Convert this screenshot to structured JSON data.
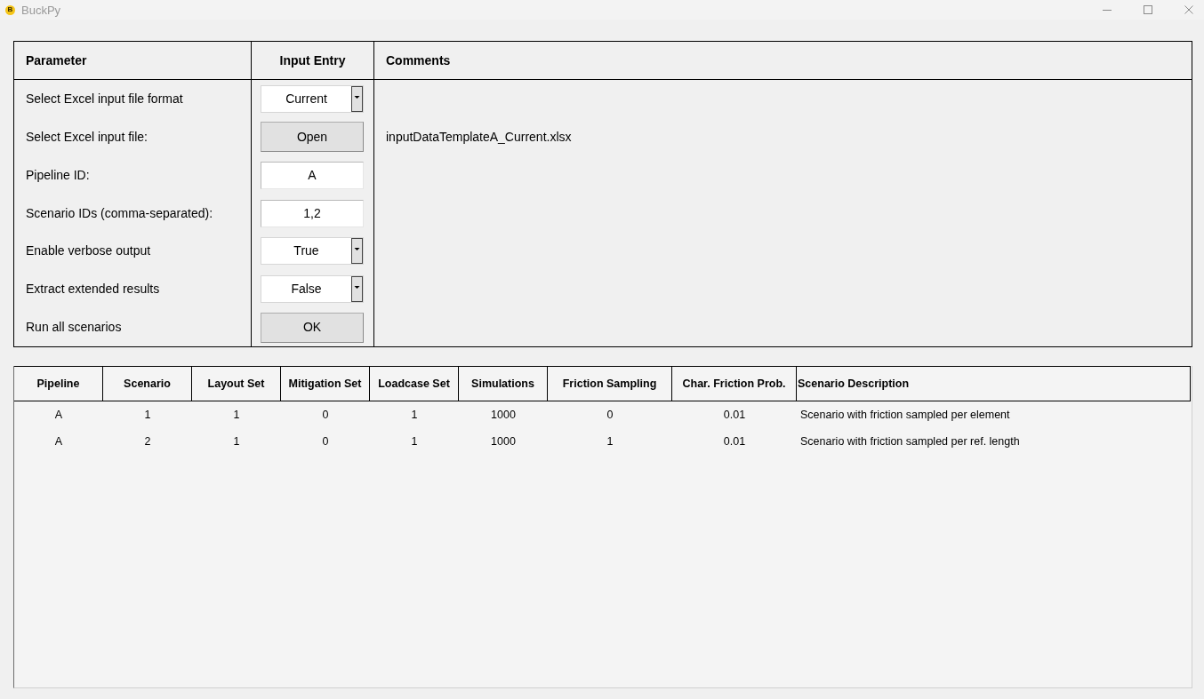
{
  "window": {
    "title": "BuckPy",
    "icon_letter": "B"
  },
  "parameters": {
    "columns": [
      "Parameter",
      "Input Entry",
      "Comments"
    ],
    "rows": [
      {
        "label": "Select Excel input file format",
        "kind": "dropdown",
        "value": "Current"
      },
      {
        "label": "Select Excel input file:",
        "kind": "button",
        "value": "Open",
        "comment": "inputDataTemplateA_Current.xlsx"
      },
      {
        "label": "Pipeline ID:",
        "kind": "entry",
        "value": "A"
      },
      {
        "label": "Scenario IDs (comma-separated):",
        "kind": "entry",
        "value": "1,2"
      },
      {
        "label": "Enable verbose output",
        "kind": "dropdown",
        "value": "True"
      },
      {
        "label": "Extract extended results",
        "kind": "dropdown",
        "value": "False"
      },
      {
        "label": "Run all scenarios",
        "kind": "button",
        "value": "OK"
      }
    ]
  },
  "scenarios": {
    "columns": [
      "Pipeline",
      "Scenario",
      "Layout Set",
      "Mitigation Set",
      "Loadcase Set",
      "Simulations",
      "Friction Sampling",
      "Char. Friction Prob.",
      "Scenario Description"
    ],
    "rows": [
      [
        "A",
        "1",
        "1",
        "0",
        "1",
        "1000",
        "0",
        "0.01",
        "Scenario with friction sampled per element"
      ],
      [
        "A",
        "2",
        "1",
        "0",
        "1",
        "1000",
        "1",
        "0.01",
        "Scenario with friction sampled per ref. length"
      ]
    ]
  }
}
